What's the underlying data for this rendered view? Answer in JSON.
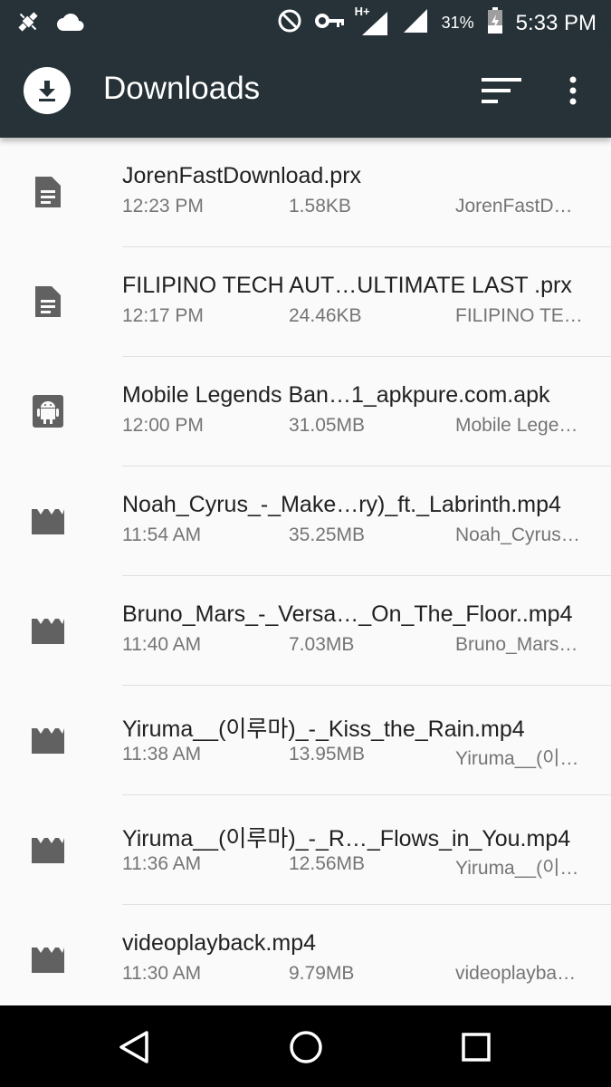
{
  "status_bar": {
    "time": "5:33 PM",
    "battery_percent": "31%",
    "network_label": "H+",
    "left_icons": [
      "satellite-icon",
      "cloud-icon"
    ],
    "right_icons": [
      "do-not-disturb-icon",
      "vpn-key-icon",
      "signal-icon",
      "signal-icon",
      "battery-icon"
    ]
  },
  "app_bar": {
    "title": "Downloads",
    "app_icon": "download-icon",
    "actions": [
      "sort-icon",
      "more-vert-icon"
    ]
  },
  "files": [
    {
      "name": "JorenFastDownload.prx",
      "time": "12:23 PM",
      "size": "1.58KB",
      "desc": "JorenFastD…",
      "icon": "document-icon"
    },
    {
      "name": "FILIPINO TECH AUT…ULTIMATE LAST .prx",
      "time": "12:17 PM",
      "size": "24.46KB",
      "desc": "FILIPINO TE…",
      "icon": "document-icon"
    },
    {
      "name": "Mobile Legends Ban…1_apkpure.com.apk",
      "time": "12:00 PM",
      "size": "31.05MB",
      "desc": "Mobile Lege…",
      "icon": "android-icon"
    },
    {
      "name": "Noah_Cyrus_-_Make…ry)_ft._Labrinth.mp4",
      "time": "11:54 AM",
      "size": "35.25MB",
      "desc": "Noah_Cyrus…",
      "icon": "movie-icon"
    },
    {
      "name": "Bruno_Mars_-_Versa…_On_The_Floor..mp4",
      "time": "11:40 AM",
      "size": "7.03MB",
      "desc": "Bruno_Mars…",
      "icon": "movie-icon"
    },
    {
      "name": "Yiruma__(이루마)_-_Kiss_the_Rain.mp4",
      "time": "11:38 AM",
      "size": "13.95MB",
      "desc": "Yiruma__(이…",
      "icon": "movie-icon"
    },
    {
      "name": "Yiruma__(이루마)_-_R…_Flows_in_You.mp4",
      "time": "11:36 AM",
      "size": "12.56MB",
      "desc": "Yiruma__(이…",
      "icon": "movie-icon"
    },
    {
      "name": "videoplayback.mp4",
      "time": "11:30 AM",
      "size": "9.79MB",
      "desc": "videoplayba…",
      "icon": "movie-icon"
    }
  ],
  "nav_bar": {
    "buttons": [
      "back-icon",
      "home-icon",
      "recents-icon"
    ]
  },
  "colors": {
    "app_bar": "#263238",
    "icon_gray": "#616161",
    "primary_text": "#212121",
    "secondary_text": "#757575"
  }
}
